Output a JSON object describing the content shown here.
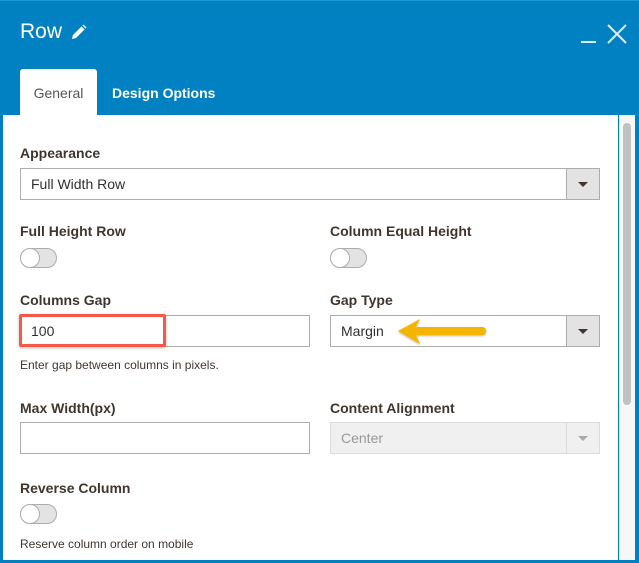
{
  "window": {
    "title": "Row",
    "title_icon": "pencil-icon",
    "controls": [
      "minimize-icon",
      "close-icon"
    ]
  },
  "tabs": [
    {
      "label": "General",
      "active": true
    },
    {
      "label": "Design Options",
      "active": false
    }
  ],
  "form": {
    "appearance": {
      "label": "Appearance",
      "value": "Full Width Row"
    },
    "full_height_row": {
      "label": "Full Height Row",
      "on": false
    },
    "column_equal_height": {
      "label": "Column Equal Height",
      "on": false
    },
    "columns_gap": {
      "label": "Columns Gap",
      "value": "100",
      "hint": "Enter gap between columns in pixels."
    },
    "gap_type": {
      "label": "Gap Type",
      "value": "Margin"
    },
    "max_width": {
      "label": "Max Width(px)",
      "value": ""
    },
    "content_alignment": {
      "label": "Content Alignment",
      "value": "Center",
      "disabled": true
    },
    "reverse_column": {
      "label": "Reverse Column",
      "on": false,
      "hint": "Reserve column order on mobile"
    }
  },
  "annotations": {
    "highlight_color": "#f4594a",
    "arrow_color": "#f5b400"
  },
  "colors": {
    "header": "#0181c1",
    "label": "#41362f"
  }
}
